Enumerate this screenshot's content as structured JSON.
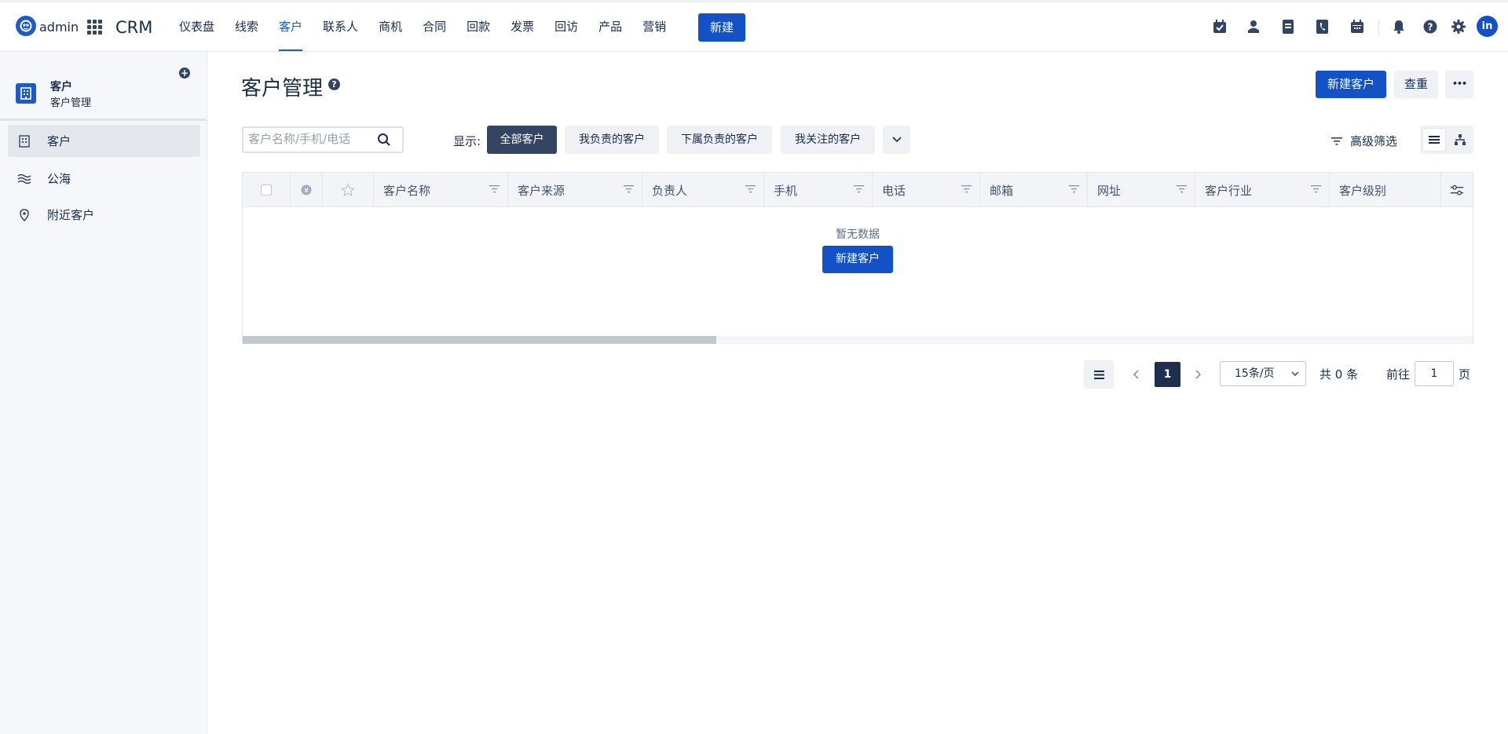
{
  "topbar": {
    "brand": "admin",
    "app_name": "CRM",
    "nav": [
      {
        "label": "仪表盘",
        "active": false
      },
      {
        "label": "线索",
        "active": false
      },
      {
        "label": "客户",
        "active": true
      },
      {
        "label": "联系人",
        "active": false
      },
      {
        "label": "商机",
        "active": false
      },
      {
        "label": "合同",
        "active": false
      },
      {
        "label": "回款",
        "active": false
      },
      {
        "label": "发票",
        "active": false
      },
      {
        "label": "回访",
        "active": false
      },
      {
        "label": "产品",
        "active": false
      },
      {
        "label": "营销",
        "active": false
      }
    ],
    "new_label": "新建",
    "tools": [
      "calendar-check-icon",
      "user-icon",
      "document-icon",
      "phone-book-icon",
      "calendar-icon",
      "bell-icon",
      "help-icon",
      "gear-icon"
    ],
    "avatar_initials": "in",
    "accent": "#1252c6"
  },
  "sidebar": {
    "title": "客户",
    "subtitle": "客户管理",
    "items": [
      {
        "label": "客户",
        "icon": "building-icon",
        "active": true
      },
      {
        "label": "公海",
        "icon": "waves-icon",
        "active": false
      },
      {
        "label": "附近客户",
        "icon": "location-pin-icon",
        "active": false
      }
    ]
  },
  "main": {
    "title": "客户管理",
    "new_customer_label": "新建客户",
    "check_duplicate_label": "查重",
    "more_label": "•••",
    "search_placeholder": "客户名称/手机/电话",
    "show_label": "显示:",
    "filters": [
      {
        "label": "全部客户",
        "active": true
      },
      {
        "label": "我负责的客户",
        "active": false
      },
      {
        "label": "下属负责的客户",
        "active": false
      },
      {
        "label": "我关注的客户",
        "active": false
      }
    ],
    "advanced_filter_label": "高级筛选",
    "columns": [
      "客户名称",
      "客户来源",
      "负责人",
      "手机",
      "电话",
      "邮箱",
      "网址",
      "客户行业",
      "客户级别"
    ],
    "empty_text": "暂无数据",
    "empty_button_label": "新建客户"
  },
  "pagination": {
    "current_page": "1",
    "page_size": "15条/页",
    "total": "共 0 条",
    "goto_label": "前往",
    "goto_value": "1",
    "page_suffix": "页"
  }
}
